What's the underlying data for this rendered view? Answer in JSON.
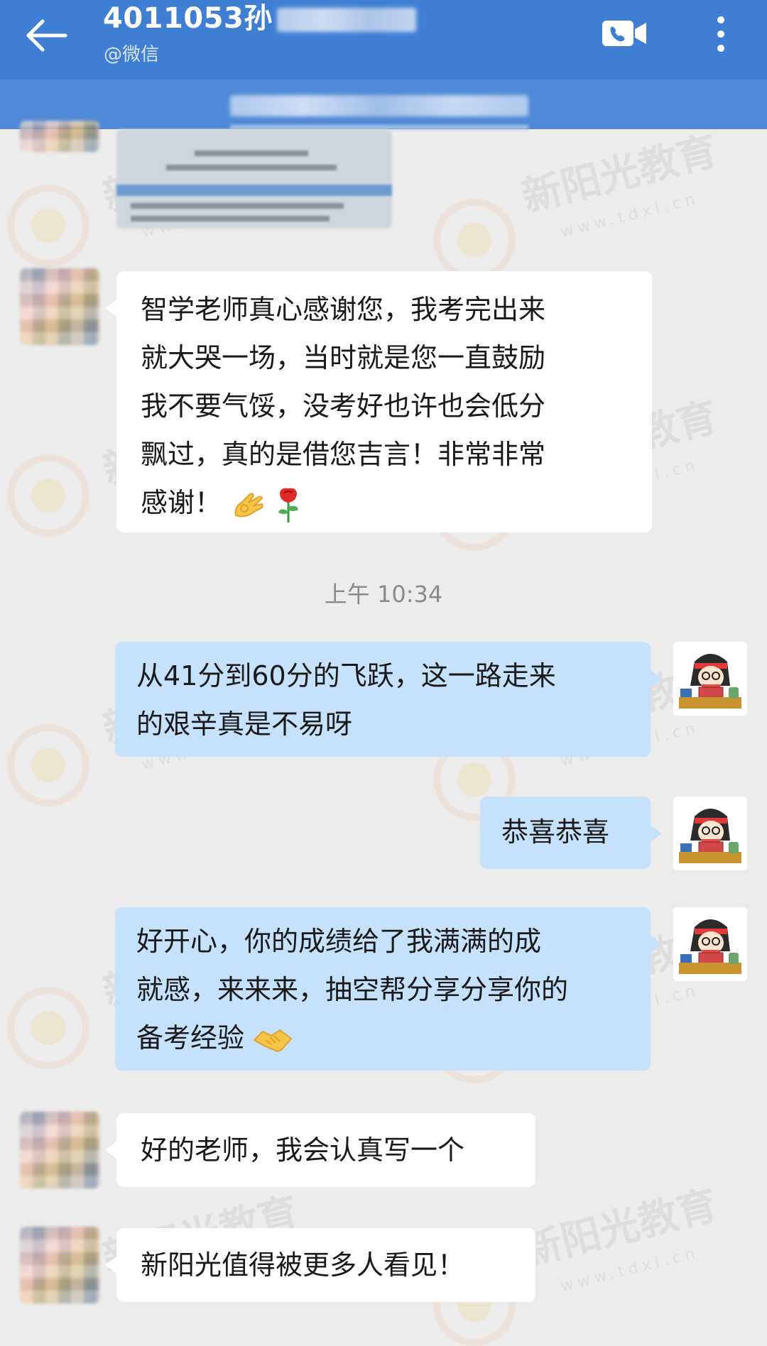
{
  "header": {
    "title": "4011053孙",
    "subtitle": "@微信",
    "back_icon": "arrow-left-icon",
    "video_icon": "video-call-icon",
    "more_icon": "more-vertical-icon"
  },
  "messages": {
    "m1": {
      "side": "left",
      "lines": [
        "智学老师真心感谢您，我考完出来",
        "就大哭一场，当时就是您一直鼓励",
        "我不要气馁，没考好也许也会低分",
        "飘过，真的是借您吉言！非常非常"
      ],
      "last_line": "感谢！"
    },
    "timestamp": "上午 10:34",
    "m2": {
      "side": "right",
      "lines": [
        "从41分到60分的飞跃，这一路走来",
        "的艰辛真是不易呀"
      ]
    },
    "m3": {
      "side": "right",
      "lines": [
        "恭喜恭喜"
      ]
    },
    "m4": {
      "side": "right",
      "lines": [
        "好开心，你的成绩给了我满满的成",
        "就感，来来来，抽空帮分享分享你的"
      ],
      "last_line": "备考经验"
    },
    "m5": {
      "side": "left",
      "lines": [
        "好的老师，我会认真写一个"
      ]
    },
    "m6": {
      "side": "left",
      "lines": [
        "新阳光值得被更多人看见！"
      ]
    }
  },
  "watermark": {
    "brand": "新阳光教育",
    "url": "www.tdxl.cn"
  },
  "colors": {
    "header_bg": "#3f7fd3",
    "chat_bg": "#ececec",
    "bubble_left": "#ffffff",
    "bubble_right": "#c5e1fb"
  }
}
